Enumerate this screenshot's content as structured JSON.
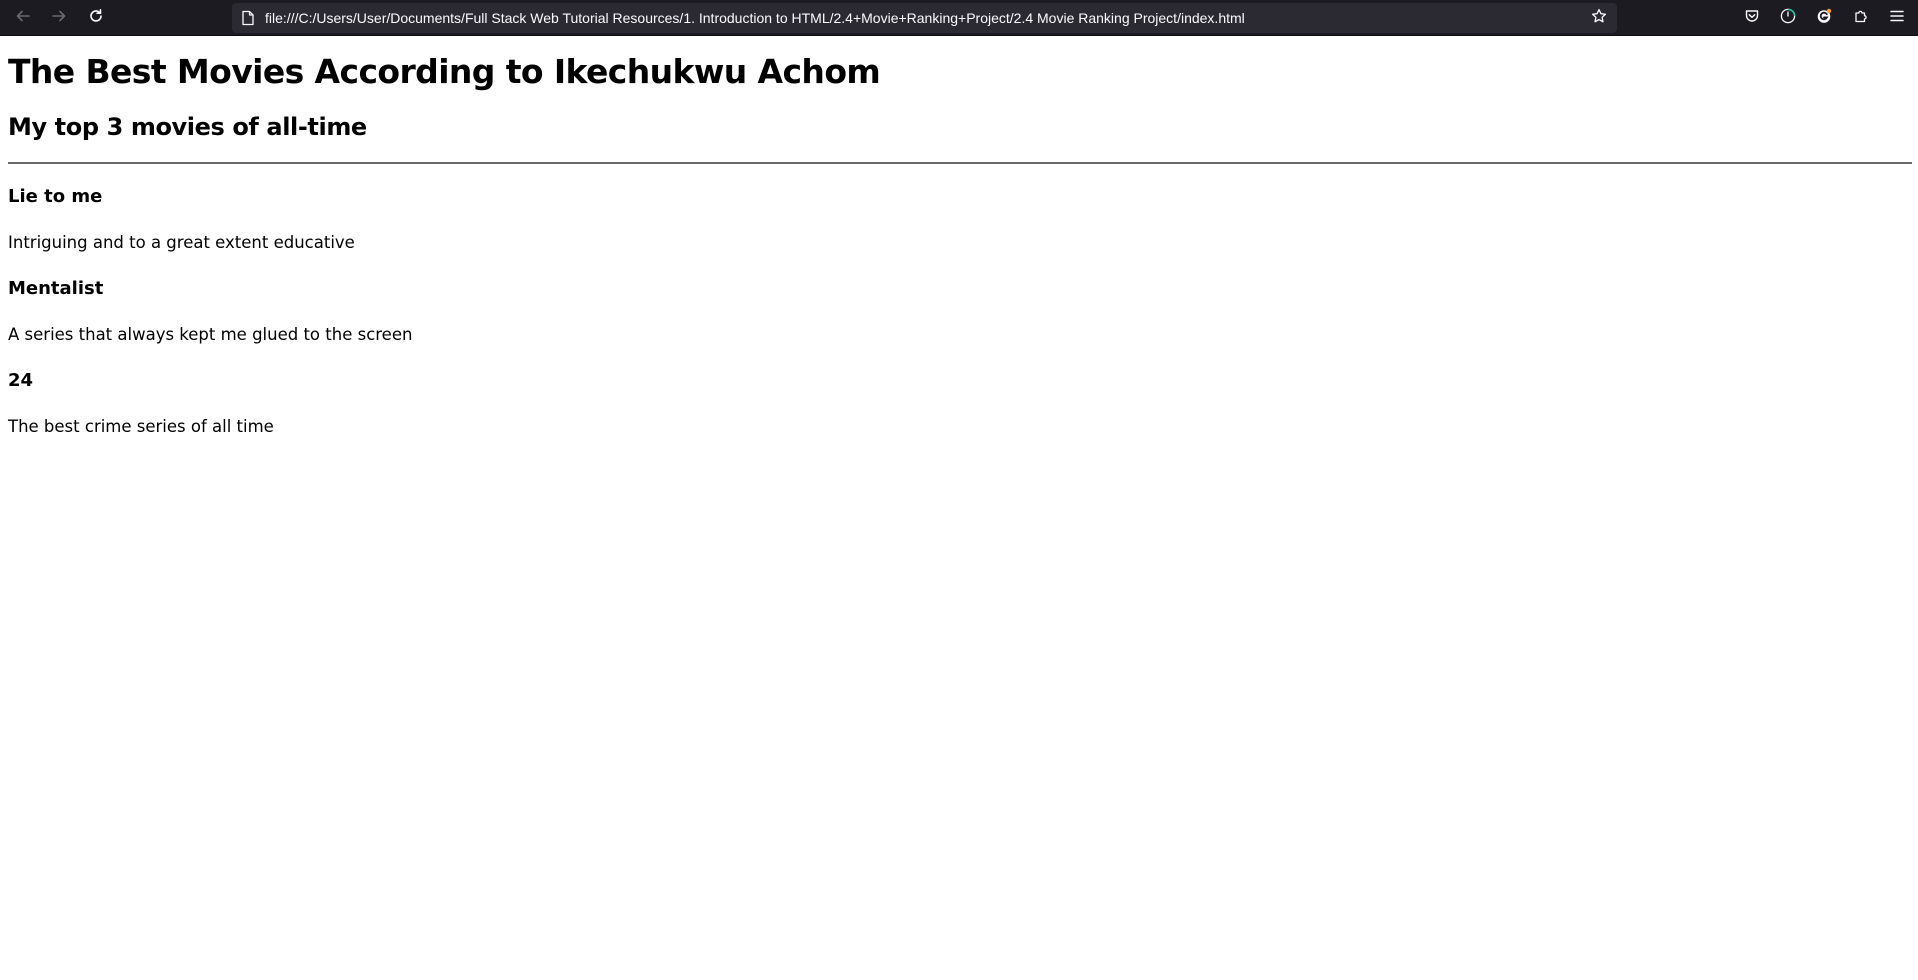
{
  "browser": {
    "url": "file:///C:/Users/User/Documents/Full Stack Web Tutorial Resources/1. Introduction to HTML/2.4+Movie+Ranking+Project/2.4 Movie Ranking Project/index.html",
    "icons": {
      "back": "back-arrow-icon",
      "forward": "forward-arrow-icon",
      "reload": "reload-icon",
      "page": "page-icon",
      "bookmark": "star-icon",
      "pocket": "pocket-icon",
      "account": "account-icon",
      "extension": "extension-badge-icon",
      "puzzle": "puzzle-icon",
      "menu": "hamburger-menu-icon"
    },
    "colors": {
      "toolbar_bg": "#1c1b22",
      "urlbar_bg": "#2b2a33",
      "text": "#fbfbfe"
    }
  },
  "page": {
    "title": "The Best Movies According to Ikechukwu Achom",
    "subtitle": "My top 3 movies of all-time",
    "movies": [
      {
        "name": "Lie to me",
        "description": "Intriguing and to a great extent educative"
      },
      {
        "name": "Mentalist",
        "description": "A series that always kept me glued to the screen"
      },
      {
        "name": "24",
        "description": "The best crime series of all time"
      }
    ]
  }
}
